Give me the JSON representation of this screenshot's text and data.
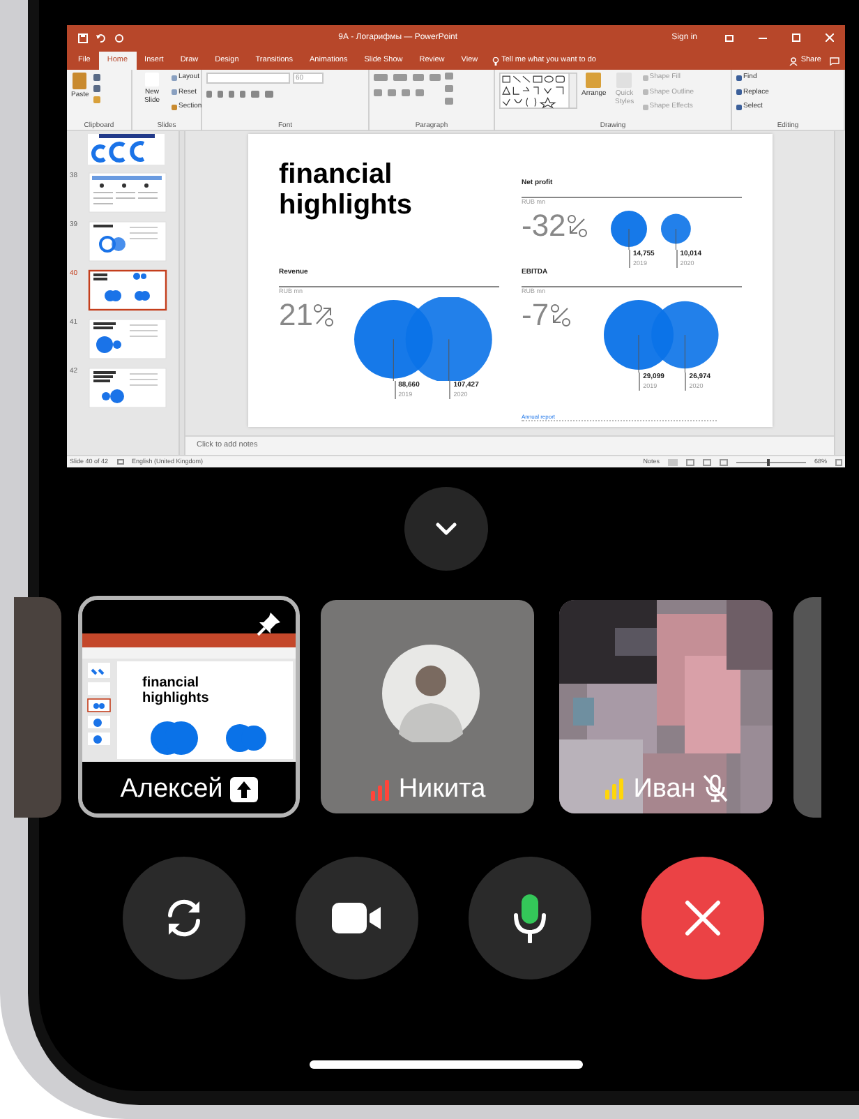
{
  "powerpoint": {
    "title": "9А - Логарифмы — PowerPoint",
    "sign_in": "Sign in",
    "share": "Share",
    "tabs": [
      {
        "label": "File",
        "selected": false
      },
      {
        "label": "Home",
        "selected": true
      },
      {
        "label": "Insert",
        "selected": false
      },
      {
        "label": "Draw",
        "selected": false
      },
      {
        "label": "Design",
        "selected": false
      },
      {
        "label": "Transitions",
        "selected": false
      },
      {
        "label": "Animations",
        "selected": false
      },
      {
        "label": "Slide Show",
        "selected": false
      },
      {
        "label": "Review",
        "selected": false
      },
      {
        "label": "View",
        "selected": false
      }
    ],
    "tell_me": "Tell me what you want to do",
    "ribbon": {
      "paste": "Paste",
      "layout": "Layout",
      "reset": "Reset",
      "new_slide": "New Slide",
      "section": "Section",
      "font_size": "60",
      "arrange": "Arrange",
      "quick_styles": "Quick Styles",
      "shape_fill": "Shape Fill",
      "shape_outline": "Shape Outline",
      "shape_effects": "Shape Effects",
      "find": "Find",
      "replace": "Replace",
      "select": "Select",
      "groups": [
        "Clipboard",
        "Slides",
        "Font",
        "Paragraph",
        "Drawing",
        "Editing"
      ]
    },
    "thumbnails": [
      {
        "number": "38",
        "selected": false
      },
      {
        "number": "39",
        "selected": false
      },
      {
        "number": "40",
        "selected": true
      },
      {
        "number": "41",
        "selected": false
      },
      {
        "number": "42",
        "selected": false
      }
    ],
    "slide": {
      "title": "financial highlights",
      "metrics": [
        {
          "name": "Net profit",
          "unit": "RUB mn",
          "change": "-32",
          "kind": "decrease",
          "bubbles": [
            {
              "value": "14,755",
              "year": "2019"
            },
            {
              "value": "10,014",
              "year": "2020"
            }
          ]
        },
        {
          "name": "Revenue",
          "unit": "RUB mn",
          "change": "21",
          "kind": "increase",
          "bubbles": [
            {
              "value": "88,660",
              "year": "2019"
            },
            {
              "value": "107,427",
              "year": "2020"
            }
          ]
        },
        {
          "name": "EBITDA",
          "unit": "RUB mn",
          "change": "-7",
          "kind": "decrease",
          "bubbles": [
            {
              "value": "29,099",
              "year": "2019"
            },
            {
              "value": "26,974",
              "year": "2020"
            }
          ]
        }
      ],
      "footer": "Annual report"
    },
    "notes_placeholder": "Click to add notes",
    "status_bar": {
      "slide": "Slide 40 of 42",
      "language": "English (United Kingdom)",
      "notes": "Notes",
      "zoom": "68%",
      "zoom_slider": {
        "level": 0.45
      }
    }
  },
  "participants": [
    {
      "name": "Алексей",
      "kind": "screen",
      "selected": true,
      "pinned": true,
      "sharing": true,
      "muted": false,
      "preview_title": "financial highlights"
    },
    {
      "name": "Никита",
      "kind": "avatar",
      "selected": false,
      "pinned": false,
      "sharing": false,
      "muted": false,
      "color": "#ff453a"
    },
    {
      "name": "Иван",
      "kind": "video",
      "selected": false,
      "pinned": false,
      "sharing": false,
      "muted": true,
      "color": "#ffd60a"
    }
  ],
  "controls": {
    "microphone_on": true
  }
}
